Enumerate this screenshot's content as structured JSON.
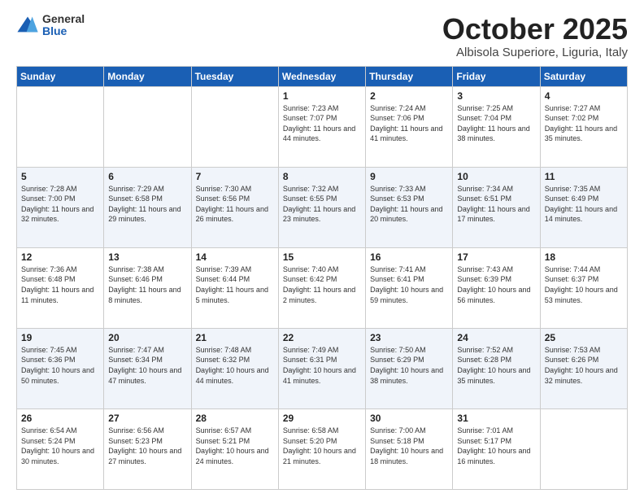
{
  "logo": {
    "general": "General",
    "blue": "Blue"
  },
  "header": {
    "month": "October 2025",
    "location": "Albisola Superiore, Liguria, Italy"
  },
  "weekdays": [
    "Sunday",
    "Monday",
    "Tuesday",
    "Wednesday",
    "Thursday",
    "Friday",
    "Saturday"
  ],
  "weeks": [
    [
      {
        "day": "",
        "info": ""
      },
      {
        "day": "",
        "info": ""
      },
      {
        "day": "",
        "info": ""
      },
      {
        "day": "1",
        "info": "Sunrise: 7:23 AM\nSunset: 7:07 PM\nDaylight: 11 hours\nand 44 minutes."
      },
      {
        "day": "2",
        "info": "Sunrise: 7:24 AM\nSunset: 7:06 PM\nDaylight: 11 hours\nand 41 minutes."
      },
      {
        "day": "3",
        "info": "Sunrise: 7:25 AM\nSunset: 7:04 PM\nDaylight: 11 hours\nand 38 minutes."
      },
      {
        "day": "4",
        "info": "Sunrise: 7:27 AM\nSunset: 7:02 PM\nDaylight: 11 hours\nand 35 minutes."
      }
    ],
    [
      {
        "day": "5",
        "info": "Sunrise: 7:28 AM\nSunset: 7:00 PM\nDaylight: 11 hours\nand 32 minutes."
      },
      {
        "day": "6",
        "info": "Sunrise: 7:29 AM\nSunset: 6:58 PM\nDaylight: 11 hours\nand 29 minutes."
      },
      {
        "day": "7",
        "info": "Sunrise: 7:30 AM\nSunset: 6:56 PM\nDaylight: 11 hours\nand 26 minutes."
      },
      {
        "day": "8",
        "info": "Sunrise: 7:32 AM\nSunset: 6:55 PM\nDaylight: 11 hours\nand 23 minutes."
      },
      {
        "day": "9",
        "info": "Sunrise: 7:33 AM\nSunset: 6:53 PM\nDaylight: 11 hours\nand 20 minutes."
      },
      {
        "day": "10",
        "info": "Sunrise: 7:34 AM\nSunset: 6:51 PM\nDaylight: 11 hours\nand 17 minutes."
      },
      {
        "day": "11",
        "info": "Sunrise: 7:35 AM\nSunset: 6:49 PM\nDaylight: 11 hours\nand 14 minutes."
      }
    ],
    [
      {
        "day": "12",
        "info": "Sunrise: 7:36 AM\nSunset: 6:48 PM\nDaylight: 11 hours\nand 11 minutes."
      },
      {
        "day": "13",
        "info": "Sunrise: 7:38 AM\nSunset: 6:46 PM\nDaylight: 11 hours\nand 8 minutes."
      },
      {
        "day": "14",
        "info": "Sunrise: 7:39 AM\nSunset: 6:44 PM\nDaylight: 11 hours\nand 5 minutes."
      },
      {
        "day": "15",
        "info": "Sunrise: 7:40 AM\nSunset: 6:42 PM\nDaylight: 11 hours\nand 2 minutes."
      },
      {
        "day": "16",
        "info": "Sunrise: 7:41 AM\nSunset: 6:41 PM\nDaylight: 10 hours\nand 59 minutes."
      },
      {
        "day": "17",
        "info": "Sunrise: 7:43 AM\nSunset: 6:39 PM\nDaylight: 10 hours\nand 56 minutes."
      },
      {
        "day": "18",
        "info": "Sunrise: 7:44 AM\nSunset: 6:37 PM\nDaylight: 10 hours\nand 53 minutes."
      }
    ],
    [
      {
        "day": "19",
        "info": "Sunrise: 7:45 AM\nSunset: 6:36 PM\nDaylight: 10 hours\nand 50 minutes."
      },
      {
        "day": "20",
        "info": "Sunrise: 7:47 AM\nSunset: 6:34 PM\nDaylight: 10 hours\nand 47 minutes."
      },
      {
        "day": "21",
        "info": "Sunrise: 7:48 AM\nSunset: 6:32 PM\nDaylight: 10 hours\nand 44 minutes."
      },
      {
        "day": "22",
        "info": "Sunrise: 7:49 AM\nSunset: 6:31 PM\nDaylight: 10 hours\nand 41 minutes."
      },
      {
        "day": "23",
        "info": "Sunrise: 7:50 AM\nSunset: 6:29 PM\nDaylight: 10 hours\nand 38 minutes."
      },
      {
        "day": "24",
        "info": "Sunrise: 7:52 AM\nSunset: 6:28 PM\nDaylight: 10 hours\nand 35 minutes."
      },
      {
        "day": "25",
        "info": "Sunrise: 7:53 AM\nSunset: 6:26 PM\nDaylight: 10 hours\nand 32 minutes."
      }
    ],
    [
      {
        "day": "26",
        "info": "Sunrise: 6:54 AM\nSunset: 5:24 PM\nDaylight: 10 hours\nand 30 minutes."
      },
      {
        "day": "27",
        "info": "Sunrise: 6:56 AM\nSunset: 5:23 PM\nDaylight: 10 hours\nand 27 minutes."
      },
      {
        "day": "28",
        "info": "Sunrise: 6:57 AM\nSunset: 5:21 PM\nDaylight: 10 hours\nand 24 minutes."
      },
      {
        "day": "29",
        "info": "Sunrise: 6:58 AM\nSunset: 5:20 PM\nDaylight: 10 hours\nand 21 minutes."
      },
      {
        "day": "30",
        "info": "Sunrise: 7:00 AM\nSunset: 5:18 PM\nDaylight: 10 hours\nand 18 minutes."
      },
      {
        "day": "31",
        "info": "Sunrise: 7:01 AM\nSunset: 5:17 PM\nDaylight: 10 hours\nand 16 minutes."
      },
      {
        "day": "",
        "info": ""
      }
    ]
  ]
}
